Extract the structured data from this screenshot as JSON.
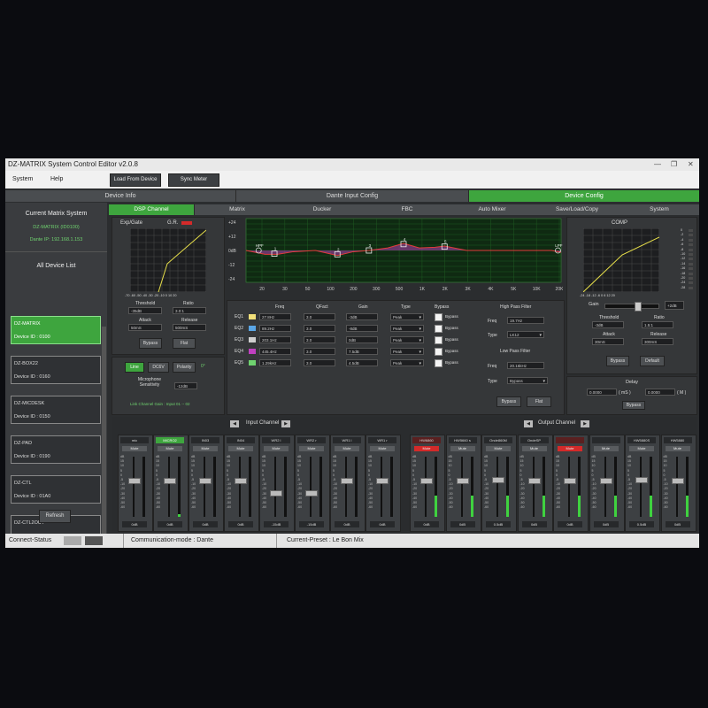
{
  "window": {
    "title": "DZ-MATRIX System Control Editor v2.0.8",
    "controls": [
      "—",
      "❐",
      "✕"
    ]
  },
  "menu": {
    "system": "System",
    "help": "Help",
    "load_from_device": "Load From Device",
    "sync_meter": "Sync Meter"
  },
  "top_tabs": [
    {
      "label": "Device Info",
      "active": false
    },
    {
      "label": "Dante Input Config",
      "active": false
    },
    {
      "label": "Device Config",
      "active": true
    }
  ],
  "sub_tabs": [
    {
      "label": "DSP Channel",
      "active": true
    },
    {
      "label": "Matrix",
      "active": false
    },
    {
      "label": "Ducker",
      "active": false
    },
    {
      "label": "FBC",
      "active": false
    },
    {
      "label": "Auto Mixer",
      "active": false
    },
    {
      "label": "Save/Load/Copy",
      "active": false
    },
    {
      "label": "System",
      "active": false
    }
  ],
  "left": {
    "current_title": "Current Matrix System",
    "current_device": "DZ-MATRIX (ID0100)",
    "dante_ip": "Dante IP: 192.168.1.153",
    "list_title": "All Device List",
    "devices": [
      {
        "name": "DZ-MATRIX",
        "id": "Device ID : 0100",
        "selected": true
      },
      {
        "name": "DZ-BOX22",
        "id": "Device ID : 0160",
        "selected": false
      },
      {
        "name": "DZ-MICDESK",
        "id": "Device ID : 0150",
        "selected": false
      },
      {
        "name": "DZ-PAD",
        "id": "Device ID : 0190",
        "selected": false
      },
      {
        "name": "DZ-CTL",
        "id": "Device ID : 01A0",
        "selected": false
      },
      {
        "name": "DZ-CTL2OUT",
        "id": "Device ID : 01B0",
        "selected": false
      }
    ],
    "refresh": "Refresh"
  },
  "expgate": {
    "title": "Exp/Gate",
    "gr": "G.R.",
    "axis": "-70 -60 -50 -40 -30 -20 -10 0 10 20",
    "threshold_label": "Threshold",
    "threshold": "-35dB",
    "ratio_label": "Ratio",
    "ratio": "3.0:1",
    "attack_label": "Attack",
    "attack": "50mS",
    "release_label": "Release",
    "release": "500mS",
    "bypass": "Bypass",
    "flat": "Flat"
  },
  "mic": {
    "line": "Line",
    "dc6v": "DC6V",
    "polarity": "Polarity",
    "phase": "0°",
    "sens_label": "Microphone Sensitivity",
    "sens": "-12dB",
    "link": "Link Channel Gain : Input 01 -- 02"
  },
  "eq": {
    "ylabels": [
      "+24",
      "+12",
      "0dB",
      "-12",
      "-24"
    ],
    "xlabels": [
      "20",
      "30",
      "50",
      "100",
      "200",
      "300",
      "500",
      "1K",
      "2K",
      "3K",
      "4K",
      "5K",
      "10K",
      "20K"
    ],
    "markers": [
      "HPF",
      "1",
      "2",
      "3",
      "4",
      "5",
      "LPF"
    ],
    "marker_pos": [
      [
        0.04,
        0.5
      ],
      [
        0.09,
        0.55
      ],
      [
        0.29,
        0.56
      ],
      [
        0.39,
        0.5
      ],
      [
        0.5,
        0.4
      ],
      [
        0.63,
        0.44
      ],
      [
        0.99,
        0.5
      ]
    ],
    "curve": [
      [
        0,
        0.5
      ],
      [
        0.03,
        0.53
      ],
      [
        0.06,
        0.56
      ],
      [
        0.1,
        0.56
      ],
      [
        0.15,
        0.52
      ],
      [
        0.22,
        0.5
      ],
      [
        0.29,
        0.58
      ],
      [
        0.34,
        0.52
      ],
      [
        0.39,
        0.5
      ],
      [
        0.45,
        0.46
      ],
      [
        0.5,
        0.39
      ],
      [
        0.55,
        0.46
      ],
      [
        0.6,
        0.45
      ],
      [
        0.63,
        0.43
      ],
      [
        0.7,
        0.5
      ],
      [
        0.8,
        0.5
      ],
      [
        0.97,
        0.5
      ],
      [
        1,
        0.53
      ]
    ],
    "headers": {
      "freq": "Freq",
      "qfact": "QFact",
      "gain": "Gain",
      "type": "Type",
      "bypass": "Bypass"
    },
    "rows": [
      {
        "label": "EQ1",
        "color": "#f2e07a",
        "freq": "27.8Hz",
        "q": "3.0",
        "gain": "-3dB",
        "type": "Peak",
        "bypass": "Bypass"
      },
      {
        "label": "EQ2",
        "color": "#5aa6e6",
        "freq": "89.2Hz",
        "q": "3.0",
        "gain": "-8dB",
        "type": "Peak",
        "bypass": "Bypass"
      },
      {
        "label": "EQ3",
        "color": "#cfcfcf",
        "freq": "203.1Hz",
        "q": "3.0",
        "gain": "0dB",
        "type": "Peak",
        "bypass": "Bypass"
      },
      {
        "label": "EQ4",
        "color": "#c040c0",
        "freq": "445.4Hz",
        "q": "3.0",
        "gain": "7.5dB",
        "type": "Peak",
        "bypass": "Bypass"
      },
      {
        "label": "EQ5",
        "color": "#6fd26f",
        "freq": "1.29kHz",
        "q": "3.0",
        "gain": "4.5dB",
        "type": "Peak",
        "bypass": "Bypass"
      }
    ],
    "hpf_title": "High Pass Filter",
    "hpf_freq_label": "Freq",
    "hpf_freq": "19.7Hz",
    "hpf_type_label": "Type",
    "hpf_type": "LK12",
    "lpf_title": "Low Pass Filter",
    "lpf_freq_label": "Freq",
    "lpf_freq": "20.16kHz",
    "lpf_type_label": "Type",
    "lpf_type": "Bypass",
    "bypass": "Bypass",
    "flat": "Flat"
  },
  "comp": {
    "title": "COMP",
    "axis": "-24 -18 -12 -6 0 6 12 20",
    "gain_label": "Gain",
    "gain_value": "+2dB",
    "gain_level": 0.55,
    "threshold_label": "Threshold",
    "threshold": "-3dB",
    "ratio_label": "Ratio",
    "ratio": "1.5:1",
    "attack_label": "Attack",
    "attack": "30mS",
    "release_label": "Release",
    "release": "300mS",
    "bypass": "Bypass",
    "default": "Default",
    "meter_scale": [
      "0",
      "-2",
      "-4",
      "-6",
      "-8",
      "-10",
      "-12",
      "-14",
      "-16",
      "-18",
      "-20",
      "-24",
      "-28"
    ],
    "delay_title": "Delay",
    "delay_ms": "0.0000",
    "delay_ms_unit": "( mS )",
    "delay_m": "0.0000",
    "delay_m_unit": "( M )",
    "delay_bypass": "Bypass"
  },
  "mixer": {
    "input_label": "Input Channel",
    "output_label": "Output Channel",
    "scale": [
      "dB",
      "15",
      "10",
      "5",
      "0",
      "-5",
      "-10",
      "-20",
      "-30",
      "-40",
      "-50",
      "-60"
    ],
    "inputs": [
      {
        "name": "mic",
        "mute": "Mute",
        "value": "0dB",
        "level": 0.62,
        "meter": 0.0,
        "active": false
      },
      {
        "name": "MICRO2",
        "mute": "Mute",
        "value": "0dB",
        "level": 0.62,
        "meter": 0.05,
        "active": true
      },
      {
        "name": "IN03",
        "mute": "Mute",
        "value": "0dB",
        "level": 0.62,
        "meter": 0.0,
        "active": false
      },
      {
        "name": "IN04",
        "mute": "Mute",
        "value": "0dB",
        "level": 0.62,
        "meter": 0.0,
        "active": false
      },
      {
        "name": "WR2 l",
        "mute": "Mute",
        "value": "-15dB",
        "level": 0.4,
        "meter": 0.0,
        "active": false
      },
      {
        "name": "WR2 r",
        "mute": "Mute",
        "value": "-15dB",
        "level": 0.4,
        "meter": 0.0,
        "active": false
      },
      {
        "name": "WR1 l",
        "mute": "Mute",
        "value": "0dB",
        "level": 0.62,
        "meter": 0.0,
        "active": false
      },
      {
        "name": "WR1 r",
        "mute": "Mute",
        "value": "0dB",
        "level": 0.62,
        "meter": 0.0,
        "active": false
      }
    ],
    "outputs": [
      {
        "name": "HW6860",
        "mute": "Mute",
        "value": "0dB",
        "level": 0.62,
        "meter": 0.35,
        "red": true
      },
      {
        "name": "HW5660 s",
        "mute": "Mute",
        "value": "0dB",
        "level": 0.62,
        "meter": 0.35,
        "red": false
      },
      {
        "name": "Onde860M",
        "mute": "Mute",
        "value": "0.5dB",
        "level": 0.63,
        "meter": 0.35,
        "red": false
      },
      {
        "name": "OndeSP",
        "mute": "Mute",
        "value": "0dB",
        "level": 0.62,
        "meter": 0.35,
        "red": false
      },
      {
        "name": "",
        "mute": "Mute",
        "value": "0dB",
        "level": 0.62,
        "meter": 0.35,
        "red": true
      },
      {
        "name": "",
        "mute": "Mute",
        "value": "0dB",
        "level": 0.62,
        "meter": 0.35,
        "red": false
      },
      {
        "name": "HW5880S",
        "mute": "Mute",
        "value": "0.5dB",
        "level": 0.63,
        "meter": 0.35,
        "red": false
      },
      {
        "name": "HW5880",
        "mute": "Mute",
        "value": "0dB",
        "level": 0.62,
        "meter": 0.35,
        "red": false
      }
    ]
  },
  "status": {
    "connect": "Connect-Status",
    "mode": "Communication-mode : Dante",
    "preset": "Current-Preset : Le Bon Mix"
  }
}
